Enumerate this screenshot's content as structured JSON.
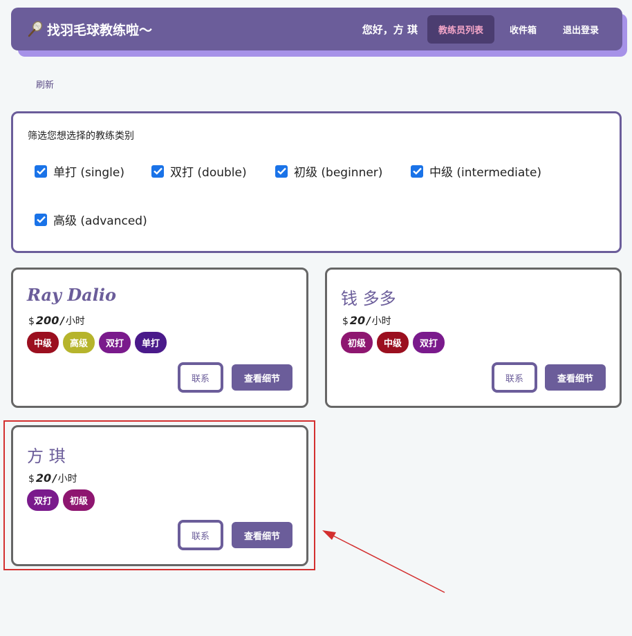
{
  "nav": {
    "brand": "找羽毛球教练啦～",
    "greeting": "您好，方 琪",
    "links": [
      "教练员列表",
      "收件箱",
      "退出登录"
    ],
    "accent": "#6b5d9a",
    "active_color": "#f4a6c8"
  },
  "refresh": "刷新",
  "filter": {
    "title": "筛选您想选择的教练类别",
    "options": [
      "单打 (single)",
      "双打 (double)",
      "初级 (beginner)",
      "中级 (intermediate)",
      "高级 (advanced)"
    ]
  },
  "coaches": [
    {
      "name": "Ray Dalio",
      "currency": "$",
      "price": "200",
      "unit": "/小时",
      "tags": [
        {
          "label": "中级",
          "color": "#9b0f1f"
        },
        {
          "label": "高级",
          "color": "#b6b42c"
        },
        {
          "label": "双打",
          "color": "#7a1a8c"
        },
        {
          "label": "单打",
          "color": "#4a1a8a"
        }
      ],
      "contact": "联系",
      "detail": "查看细节"
    },
    {
      "name": "钱 多多",
      "currency": "$",
      "price": "20",
      "unit": "/小时",
      "tags": [
        {
          "label": "初级",
          "color": "#8e1670"
        },
        {
          "label": "中级",
          "color": "#9b0f1f"
        },
        {
          "label": "双打",
          "color": "#7a1a8c"
        }
      ],
      "contact": "联系",
      "detail": "查看细节"
    },
    {
      "name": "方 琪",
      "currency": "$",
      "price": "20",
      "unit": "/小时",
      "tags": [
        {
          "label": "双打",
          "color": "#7a1a8c"
        },
        {
          "label": "初级",
          "color": "#8e1670"
        }
      ],
      "contact": "联系",
      "detail": "查看细节"
    }
  ],
  "annotation_color": "#d32f2f"
}
